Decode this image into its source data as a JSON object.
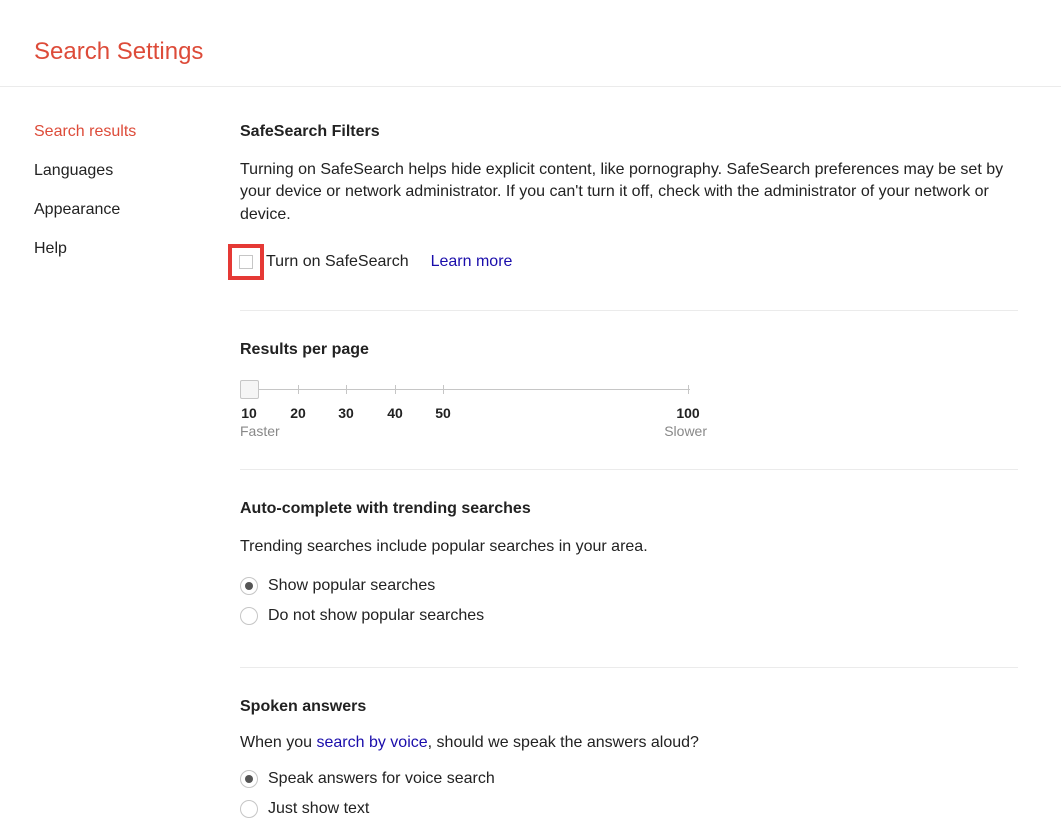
{
  "header": {
    "title": "Search Settings"
  },
  "sidebar": {
    "items": [
      {
        "label": "Search results",
        "active": true
      },
      {
        "label": "Languages",
        "active": false
      },
      {
        "label": "Appearance",
        "active": false
      },
      {
        "label": "Help",
        "active": false
      }
    ]
  },
  "safesearch": {
    "heading": "SafeSearch Filters",
    "description": "Turning on SafeSearch helps hide explicit content, like pornography. SafeSearch preferences may be set by your device or network administrator. If you can't turn it off, check with the administrator of your network or device.",
    "checkbox_label": "Turn on SafeSearch",
    "learn_more": "Learn more",
    "checked": false
  },
  "results_per_page": {
    "heading": "Results per page",
    "ticks": [
      "10",
      "20",
      "30",
      "40",
      "50",
      "100"
    ],
    "faster": "Faster",
    "slower": "Slower",
    "value": 10
  },
  "autocomplete": {
    "heading": "Auto-complete with trending searches",
    "description": "Trending searches include popular searches in your area.",
    "options": [
      {
        "label": "Show popular searches",
        "selected": true
      },
      {
        "label": "Do not show popular searches",
        "selected": false
      }
    ]
  },
  "spoken": {
    "heading": "Spoken answers",
    "prefix": "When you ",
    "link": "search by voice",
    "suffix": ", should we speak the answers aloud?",
    "options": [
      {
        "label": "Speak answers for voice search",
        "selected": true
      },
      {
        "label": "Just show text",
        "selected": false
      }
    ]
  }
}
